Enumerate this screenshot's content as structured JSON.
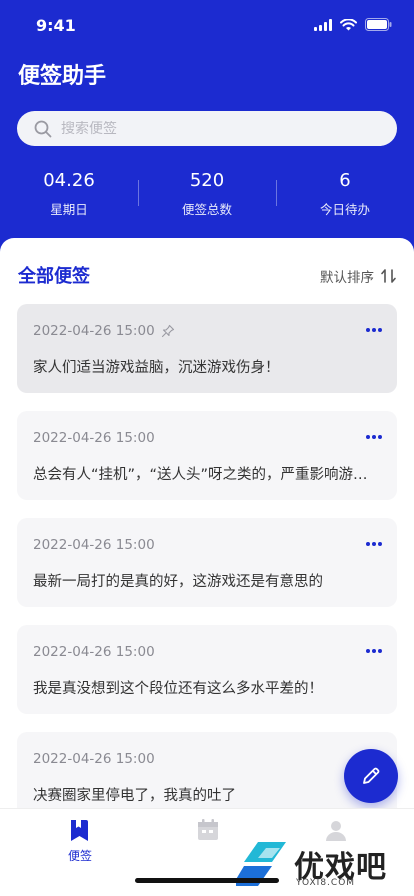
{
  "status_bar": {
    "time": "9:41"
  },
  "app": {
    "title": "便签助手"
  },
  "search": {
    "placeholder": "搜索便签"
  },
  "stats": [
    {
      "value": "04.26",
      "label": "星期日"
    },
    {
      "value": "520",
      "label": "便签总数"
    },
    {
      "value": "6",
      "label": "今日待办"
    }
  ],
  "section": {
    "title": "全部便签",
    "sort_label": "默认排序"
  },
  "notes": [
    {
      "time": "2022-04-26  15:00",
      "pinned": true,
      "text": "家人们适当游戏益脑，沉迷游戏伤身！"
    },
    {
      "time": "2022-04-26  15:00",
      "pinned": false,
      "text": "总会有人“挂机”，“送人头”呀之类的，严重影响游戏体验"
    },
    {
      "time": "2022-04-26  15:00",
      "pinned": false,
      "text": "最新一局打的是真的好，这游戏还是有意思的"
    },
    {
      "time": "2022-04-26  15:00",
      "pinned": false,
      "text": "我是真没想到这个段位还有这么多水平差的！"
    },
    {
      "time": "2022-04-26  15:00",
      "pinned": false,
      "text": "决赛圈家里停电了，我真的吐了"
    }
  ],
  "tabs": [
    {
      "label": "便签",
      "active": true
    },
    {
      "label": "",
      "active": false
    },
    {
      "label": "",
      "active": false
    }
  ],
  "watermark": {
    "name": "优戏吧",
    "url": "YOXI8.COM"
  },
  "colors": {
    "primary": "#1c2bd0",
    "card": "#f6f6f8",
    "card_pinned": "#e9e9ec"
  },
  "icons": [
    "signal-icon",
    "wifi-icon",
    "battery-icon",
    "search-icon",
    "sort-icon",
    "pin-icon",
    "more-icon",
    "edit-icon",
    "bookmark-icon",
    "calendar-icon",
    "profile-icon"
  ]
}
